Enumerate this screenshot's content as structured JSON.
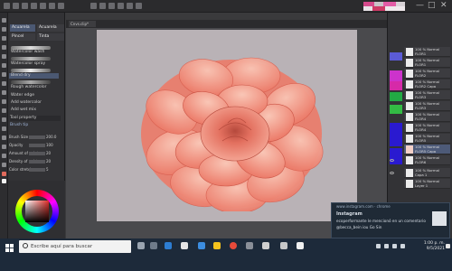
{
  "app": {
    "document_tab": "Cnvs.clip*",
    "window_controls": [
      "—",
      "□",
      "✕"
    ]
  },
  "subtool": {
    "tab_a": "Acuarela",
    "tab_b": "Acuarela",
    "tab_c": "Pincel",
    "tab_d": "Tinta",
    "brushes": [
      "Watercolor wash",
      "Watercolor spray",
      "Blend dry",
      "Rough watercolor",
      "Water edge",
      "Add watercolor",
      "Add wet mix"
    ],
    "props_header": "Tool property",
    "props_sub": "Brush tip",
    "props": [
      {
        "label": "Brush Size",
        "value": "200.0"
      },
      {
        "label": "Opacity",
        "value": "100"
      },
      {
        "label": "Amount of paint",
        "value": "20"
      },
      {
        "label": "Density of paint",
        "value": "20"
      },
      {
        "label": "Color stretch",
        "value": "5"
      }
    ]
  },
  "layers": [
    {
      "name": "100 % Normal",
      "sub": "FLOR1"
    },
    {
      "name": "100 % Normal",
      "sub": "FLOR1"
    },
    {
      "name": "100 % Normal",
      "sub": "FLOR2"
    },
    {
      "name": "100 % Normal",
      "sub": "FLOR2 Capa"
    },
    {
      "name": "100 % Normal",
      "sub": "FLOR3"
    },
    {
      "name": "100 % Normal",
      "sub": "FLOR3"
    },
    {
      "name": "100 % Normal",
      "sub": "FLOR4"
    },
    {
      "name": "100 % Normal",
      "sub": "FLOR4"
    },
    {
      "name": "100 % Normal",
      "sub": "FLOR5"
    },
    {
      "name": "100 % Normal",
      "sub": "FLOR5 Capa"
    },
    {
      "name": "100 % Normal",
      "sub": "FLOR6"
    },
    {
      "name": "100 % Normal",
      "sub": "Capa 1"
    },
    {
      "name": "100 % Normal",
      "sub": "Layer 1"
    }
  ],
  "layer_colors": [
    "#5b5bd6",
    "#cc33cc",
    "#d62aa8",
    "#22aa44",
    "#33bb44",
    "#2a1ad0",
    "#2a1ad0"
  ],
  "notification": {
    "app": "www.instagram.com",
    "sender": "chrome",
    "title": "Instagram",
    "line1": "ecoperformante le mencionó en un comentario",
    "line2": "@becca_bein iou Go Sin"
  },
  "taskbar": {
    "search_placeholder": "Escribe aquí para buscar",
    "time": "1:00 p. m.",
    "date": "9/5/2021"
  },
  "colors": {
    "accent_selected": "#4d5a78",
    "petal_main": "#ec7a68",
    "petal_light": "#f6b3a2",
    "petal_dark": "#b5493c",
    "paper": "#b9b2b6"
  }
}
